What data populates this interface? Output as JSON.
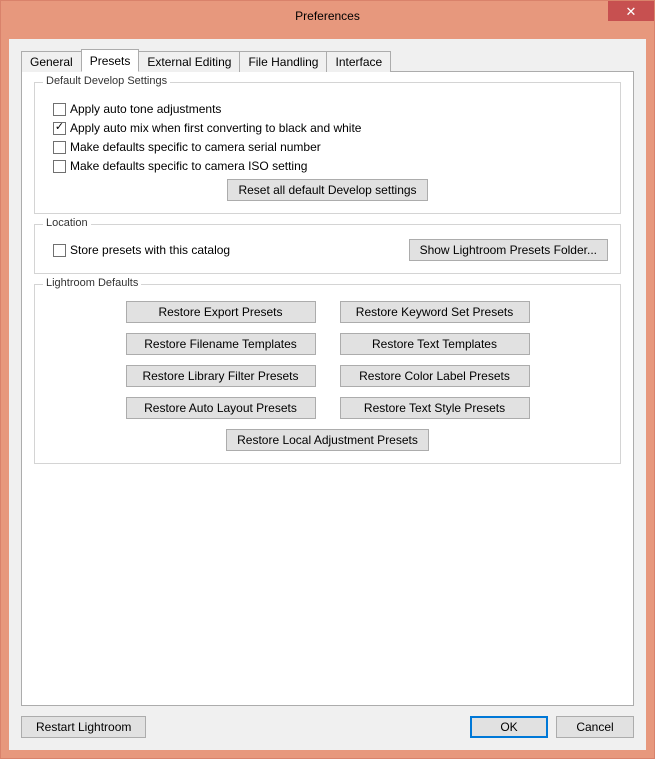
{
  "window": {
    "title": "Preferences"
  },
  "tabs": {
    "general": "General",
    "presets": "Presets",
    "external": "External Editing",
    "filehandling": "File Handling",
    "interface": "Interface",
    "active": "presets"
  },
  "group_develop": {
    "legend": "Default Develop Settings",
    "cb_autotone": {
      "label": "Apply auto tone adjustments",
      "checked": false
    },
    "cb_automix": {
      "label": "Apply auto mix when first converting to black and white",
      "checked": true
    },
    "cb_serial": {
      "label": "Make defaults specific to camera serial number",
      "checked": false
    },
    "cb_iso": {
      "label": "Make defaults specific to camera ISO setting",
      "checked": false
    },
    "btn_reset": "Reset all default Develop settings"
  },
  "group_location": {
    "legend": "Location",
    "cb_store": {
      "label": "Store presets with this catalog",
      "checked": false
    },
    "btn_show": "Show Lightroom Presets Folder..."
  },
  "group_defaults": {
    "legend": "Lightroom Defaults",
    "btn_export": "Restore Export Presets",
    "btn_keyword": "Restore Keyword Set Presets",
    "btn_filename": "Restore Filename Templates",
    "btn_text": "Restore Text Templates",
    "btn_libfilter": "Restore Library Filter Presets",
    "btn_colorlabel": "Restore Color Label Presets",
    "btn_autolayout": "Restore Auto Layout Presets",
    "btn_textstyle": "Restore Text Style Presets",
    "btn_localadjust": "Restore Local Adjustment Presets"
  },
  "footer": {
    "restart": "Restart Lightroom",
    "ok": "OK",
    "cancel": "Cancel"
  }
}
